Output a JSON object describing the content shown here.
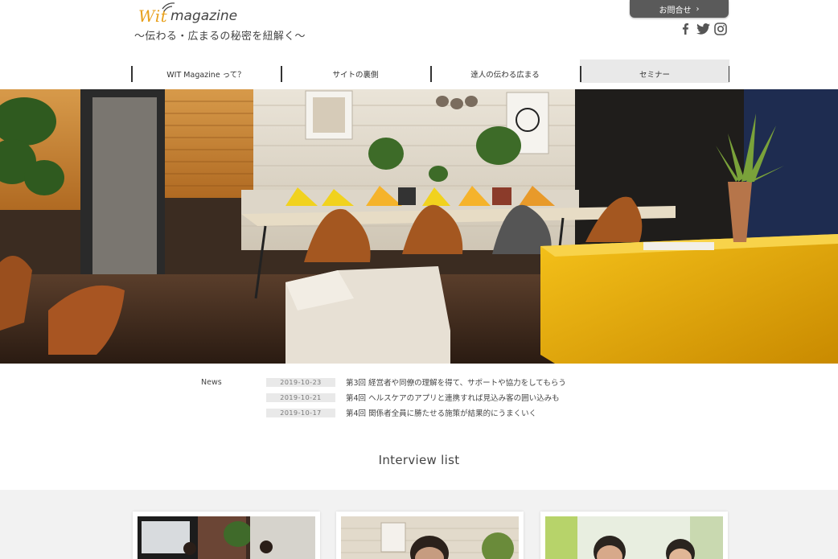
{
  "header": {
    "logo_wit": "Wit",
    "logo_magazine": "magazine",
    "tagline": "〜伝わる・広まるの秘密を紐解く〜",
    "contact_label": "お問合せ",
    "contact_chevron": "›"
  },
  "social": [
    "facebook-icon",
    "twitter-icon",
    "instagram-icon"
  ],
  "nav": [
    {
      "label": "WIT Magazine って？",
      "active": false
    },
    {
      "label": "サイトの裏側",
      "active": false
    },
    {
      "label": "達人の伝わる広まる",
      "active": false
    },
    {
      "label": "セミナー",
      "active": true
    }
  ],
  "news": {
    "label": "News",
    "items": [
      {
        "date": "2019-10-23",
        "title": "第3回 経営者や同僚の理解を得て、サポートや協力をしてもらう"
      },
      {
        "date": "2019-10-21",
        "title": "第4回 ヘルスケアのアプリと連携すれば見込み客の囲い込みも"
      },
      {
        "date": "2019-10-17",
        "title": "第4回 関係者全員に勝たせる施策が結果的にうまくいく"
      }
    ]
  },
  "interview": {
    "title": "Interview list"
  },
  "colors": {
    "accent": "#e8a01c",
    "contact_bg": "#5a5a5a",
    "list_bg": "#f2f2f2"
  }
}
